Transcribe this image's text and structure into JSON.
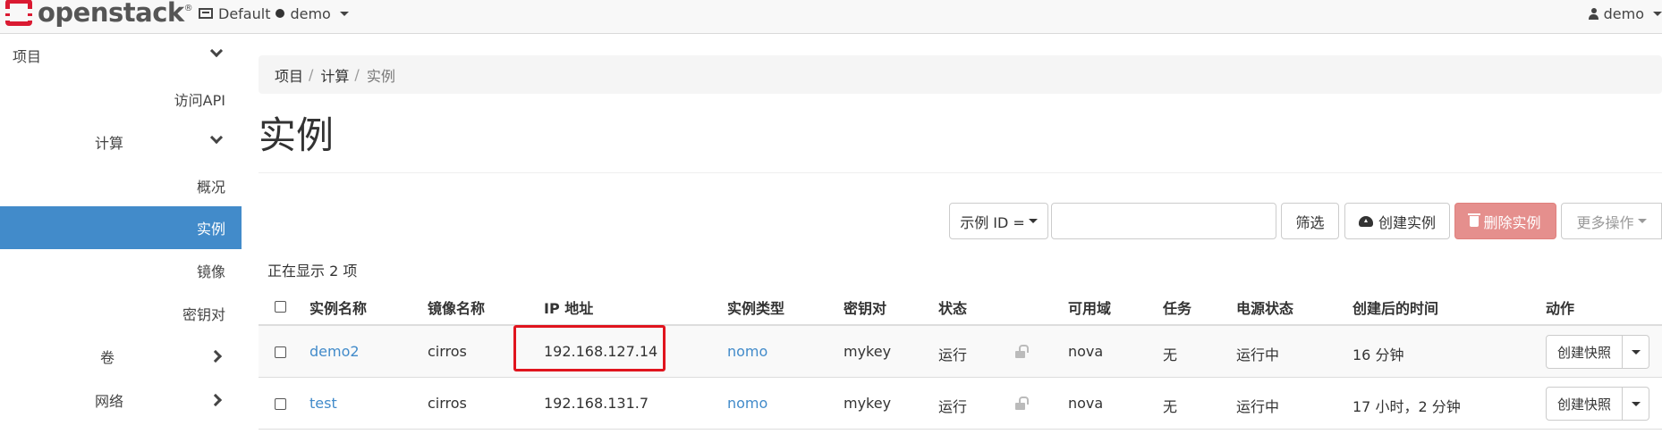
{
  "navbar": {
    "logo_text": "openstack",
    "logo_tm": "®",
    "domain": "Default",
    "project": "demo",
    "user": "demo"
  },
  "sidebar": {
    "items": [
      {
        "label": "项目"
      },
      {
        "label": "访问API"
      },
      {
        "label": "计算"
      },
      {
        "label": "概况"
      },
      {
        "label": "实例"
      },
      {
        "label": "镜像"
      },
      {
        "label": "密钥对"
      },
      {
        "label": "卷"
      },
      {
        "label": "网络"
      }
    ]
  },
  "breadcrumb": [
    "项目",
    "计算",
    "实例"
  ],
  "page_title": "实例",
  "toolbar": {
    "filter_select": "示例 ID =",
    "filter_value": "",
    "filter_button": "筛选",
    "create_button": "创建实例",
    "delete_button": "删除实例",
    "more_button": "更多操作"
  },
  "count_text": "正在显示 2 项",
  "table": {
    "headers": [
      "实例名称",
      "镜像名称",
      "IP 地址",
      "实例类型",
      "密钥对",
      "状态",
      "可用域",
      "任务",
      "电源状态",
      "创建后的时间",
      "动作"
    ],
    "rows": [
      {
        "name": "demo2",
        "image": "cirros",
        "ip": "192.168.127.14",
        "flavor": "nomo",
        "keypair": "mykey",
        "status": "运行",
        "zone": "nova",
        "task": "无",
        "power": "运行中",
        "age": "16 分钟",
        "action": "创建快照"
      },
      {
        "name": "test",
        "image": "cirros",
        "ip": "192.168.131.7",
        "flavor": "nomo",
        "keypair": "mykey",
        "status": "运行",
        "zone": "nova",
        "task": "无",
        "power": "运行中",
        "age": "17 小时，2 分钟",
        "action": "创建快照"
      }
    ]
  },
  "colors": {
    "accent": "#428bca",
    "danger": "#e58f8d",
    "brand": "#da1a32",
    "highlight": "#e0141e"
  }
}
